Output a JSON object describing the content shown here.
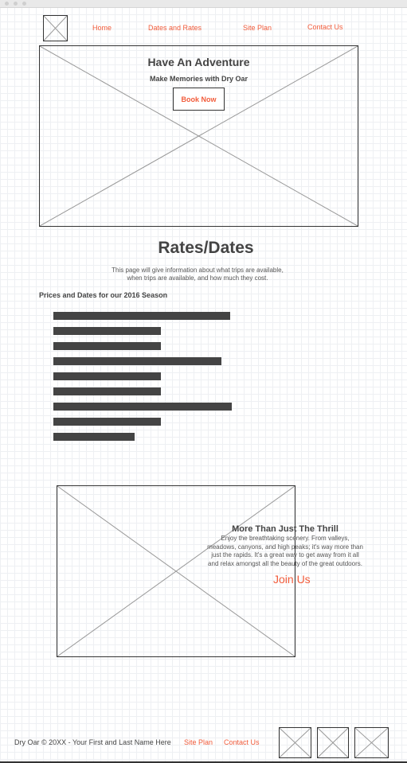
{
  "nav": {
    "home": "Home",
    "dates_rates": "Dates and Rates",
    "site_plan": "Site Plan",
    "contact": "Contact Us"
  },
  "hero": {
    "title": "Have An Adventure",
    "subtitle": "Make Memories with Dry Oar",
    "button": "Book Now"
  },
  "rates": {
    "title": "Rates/Dates",
    "intro_line1": "This page will give information about what trips are available,",
    "intro_line2": "when trips are available, and how much they cost.",
    "section_label": "Prices and Dates for our 2016 Season",
    "bar_levels": [
      1.0,
      0.61,
      0.61,
      0.95,
      0.61,
      0.61,
      1.01,
      0.61,
      0.46
    ]
  },
  "promo": {
    "title": "More Than Just The Thrill",
    "body_line1": "Enjoy the breathtaking scenery. From valleys,",
    "body_line2": "meadows, canyons, and high peaks; it's way more than",
    "body_line3": "just the rapids. It's a great way to get away from it all",
    "body_line4": "and relax amongst all the beauty of the great outdoors.",
    "cta": "Join Us"
  },
  "footer": {
    "copyright": "Dry Oar © 20XX - Your First and Last Name Here",
    "site_plan": "Site Plan",
    "contact": "Contact Us"
  },
  "colors": {
    "accent": "#f25c3b",
    "text": "#444444",
    "bar": "#444444"
  }
}
